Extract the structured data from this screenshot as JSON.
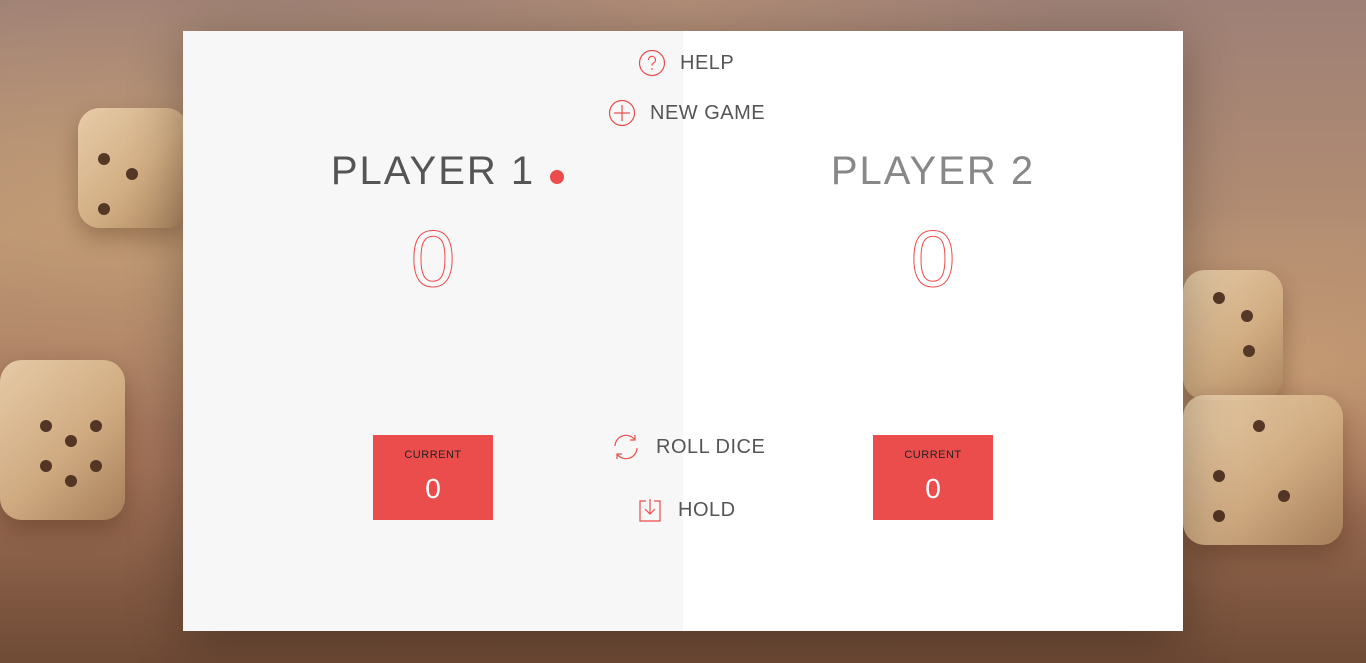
{
  "controls": {
    "help_label": "HELP",
    "new_game_label": "NEW GAME",
    "roll_dice_label": "ROLL DICE",
    "hold_label": "HOLD",
    "help_icon": "help-circle-icon",
    "new_game_icon": "plus-circle-icon",
    "roll_dice_icon": "refresh-icon",
    "hold_icon": "download-icon"
  },
  "players": [
    {
      "name": "PLAYER 1",
      "score": "0",
      "current_label": "CURRENT",
      "current_score": "0",
      "active": true
    },
    {
      "name": "PLAYER 2",
      "score": "0",
      "current_label": "CURRENT",
      "current_score": "0",
      "active": false
    }
  ],
  "colors": {
    "accent": "#eb4d4d",
    "panel_left": "#f7f7f7",
    "panel_right": "#ffffff",
    "text": "#555555"
  }
}
